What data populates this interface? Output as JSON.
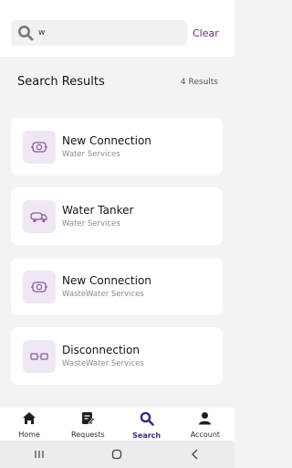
{
  "search": {
    "value": "w",
    "placeholder": "",
    "clear_label": "Clear"
  },
  "results": {
    "title": "Search Results",
    "count": "4 Results",
    "items": [
      {
        "title": "New Connection",
        "subtitle": "Water Services",
        "icon": "water-meter-icon"
      },
      {
        "title": "Water Tanker",
        "subtitle": "Water Services",
        "icon": "tanker-truck-icon"
      },
      {
        "title": "New Connection",
        "subtitle": "WasteWater Services",
        "icon": "water-meter-icon"
      },
      {
        "title": "Disconnection",
        "subtitle": "WasteWater Services",
        "icon": "disconnection-icon"
      }
    ]
  },
  "nav": {
    "items": [
      {
        "label": "Home",
        "icon": "home-icon",
        "active": false
      },
      {
        "label": "Requests",
        "icon": "requests-icon",
        "active": false
      },
      {
        "label": "Search",
        "icon": "search-icon",
        "active": true
      },
      {
        "label": "Account",
        "icon": "account-icon",
        "active": false
      }
    ]
  },
  "colors": {
    "accent": "#3c2a86",
    "clear": "#6b2b7a",
    "tile": "#efe7f3",
    "icon": "#8a5a9e"
  }
}
